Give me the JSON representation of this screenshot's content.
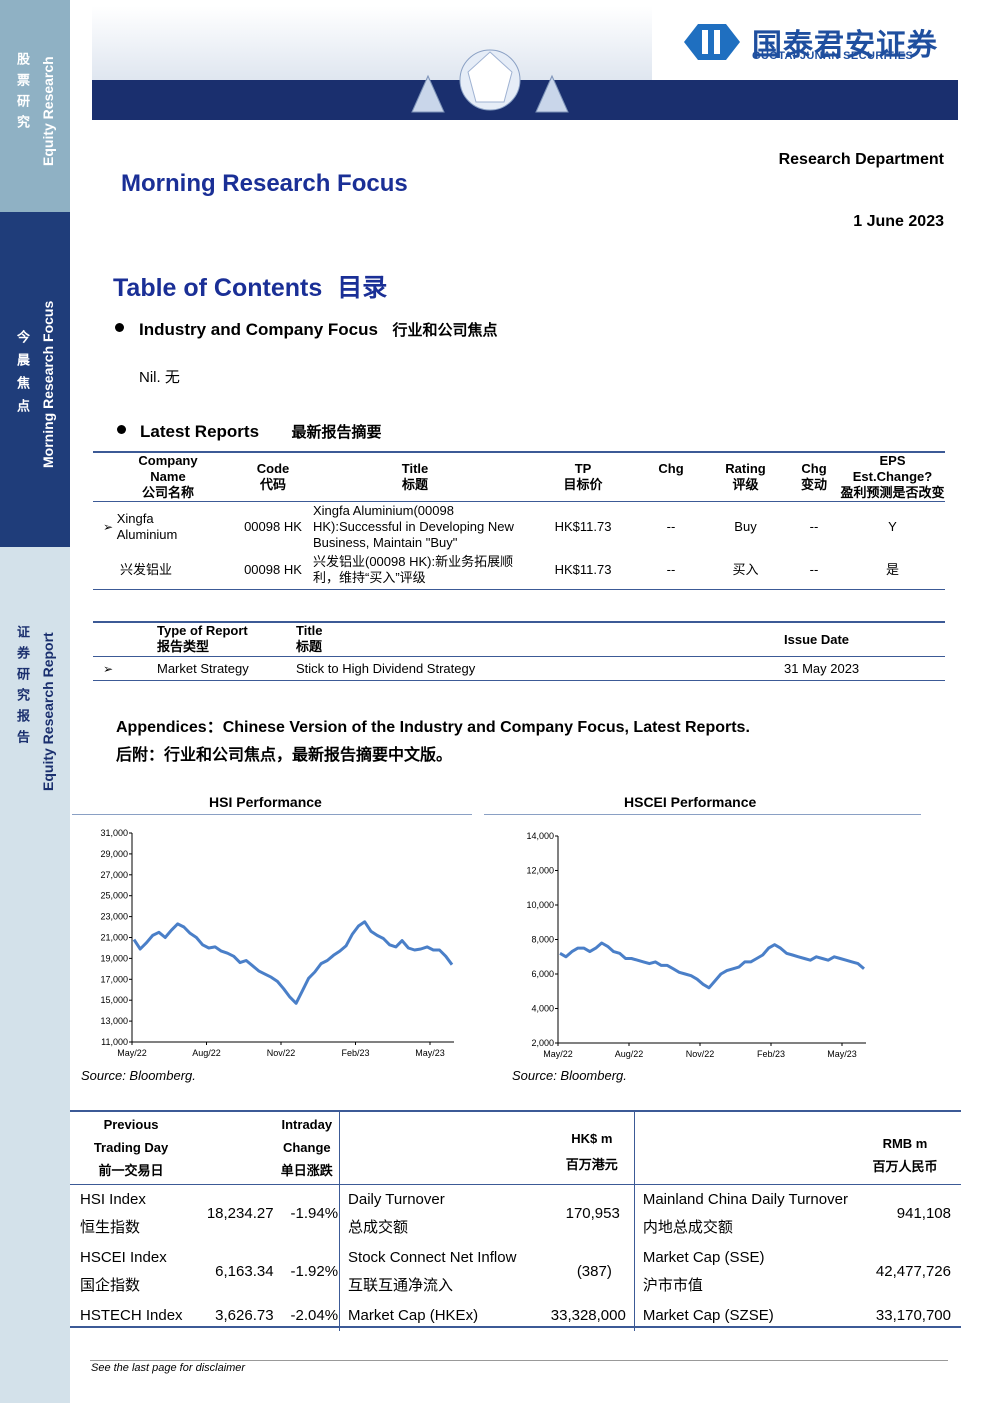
{
  "sidebar": {
    "block1_cn": "股票研究",
    "block1_en": "Equity Research",
    "block2_cn": "今晨焦点",
    "block2_en": "Morning Research Focus",
    "block3_cn": "证券研究报告",
    "block3_en": "Equity Research Report"
  },
  "header": {
    "logo_cn": "国泰君安证券",
    "logo_en": "GUOTAI JUNAN SECURITIES",
    "department": "Research Department",
    "title": "Morning Research Focus",
    "date": "1 June 2023"
  },
  "toc": {
    "title": "Table of Contents",
    "title_cn": "目录",
    "section1_en": "Industry and Company Focus",
    "section1_cn": "行业和公司焦点",
    "section1_body": "Nil.  无",
    "section2_en": "Latest Reports",
    "section2_cn": "最新报告摘要"
  },
  "latest_reports": {
    "headers": {
      "company_en": "Company",
      "company_en2": "Name",
      "company_cn": "公司名称",
      "code_en": "Code",
      "code_cn": "代码",
      "title_en": "Title",
      "title_cn": "标题",
      "tp_en": "TP",
      "tp_cn": "目标价",
      "chg": "Chg",
      "rating_en": "Rating",
      "rating_cn": "评级",
      "chg2_en": "Chg",
      "chg2_cn": "变动",
      "eps_en1": "EPS",
      "eps_en2": "Est.Change?",
      "eps_cn": "盈利预测是否改变"
    },
    "rows": [
      {
        "company": "Xingfa Aluminium",
        "code": "00098 HK",
        "title": "Xingfa Aluminium(00098 HK):Successful in Developing New Business, Maintain \"Buy\"",
        "tp": "HK$11.73",
        "chg": "--",
        "rating": "Buy",
        "chg2": "--",
        "eps": "Y"
      },
      {
        "company": "兴发铝业",
        "code": "00098 HK",
        "title": "兴发铝业(00098 HK):新业务拓展顺利，维持“买入”评级",
        "tp": "HK$11.73",
        "chg": "--",
        "rating": "买入",
        "chg2": "--",
        "eps": "是"
      }
    ],
    "bullet_glyph": "➢"
  },
  "strategy_reports": {
    "headers": {
      "type_en": "Type of Report",
      "type_cn": "报告类型",
      "title_en": "Title",
      "title_cn": "标题",
      "date": "Issue Date"
    },
    "rows": [
      {
        "type": "Market Strategy",
        "title": "Stick to High Dividend Strategy",
        "date": "31 May 2023"
      }
    ]
  },
  "appendix": {
    "line1": "Appendices：Chinese Version of the Industry and Company Focus, Latest Reports.",
    "line2": "后附：行业和公司焦点，最新报告摘要中文版。"
  },
  "chart_data": [
    {
      "type": "line",
      "title": "HSI Performance",
      "source": "Source: Bloomberg.",
      "x_ticks": [
        "May/22",
        "Aug/22",
        "Nov/22",
        "Feb/23",
        "May/23"
      ],
      "y_ticks": [
        "31,000",
        "29,000",
        "27,000",
        "25,000",
        "23,000",
        "21,000",
        "19,000",
        "17,000",
        "15,000",
        "13,000",
        "11,000"
      ],
      "ylim": [
        11000,
        31000
      ],
      "color": "#4a7fc8",
      "series": [
        {
          "values": [
            20800,
            19900,
            20500,
            21200,
            21500,
            21000,
            21700,
            22300,
            22000,
            21400,
            21000,
            20300,
            20000,
            20100,
            19700,
            19500,
            19200,
            18600,
            18800,
            18300,
            17800,
            17500,
            17200,
            16800,
            16100,
            15300,
            14700,
            15900,
            17100,
            17700,
            18500,
            18800,
            19300,
            19700,
            20200,
            21300,
            22100,
            22500,
            21600,
            21200,
            20900,
            20300,
            20100,
            20700,
            20000,
            19800,
            19900,
            20100,
            19800,
            19800,
            19200,
            18400
          ]
        }
      ]
    },
    {
      "type": "line",
      "title": "HSCEI Performance",
      "source": "Source: Bloomberg.",
      "x_ticks": [
        "May/22",
        "Aug/22",
        "Nov/22",
        "Feb/23",
        "May/23"
      ],
      "y_ticks": [
        "14,000",
        "12,000",
        "10,000",
        "8,000",
        "6,000",
        "4,000",
        "2,000"
      ],
      "ylim": [
        2000,
        14000
      ],
      "color": "#4a7fc8",
      "series": [
        {
          "values": [
            7200,
            7000,
            7300,
            7500,
            7500,
            7300,
            7500,
            7800,
            7600,
            7300,
            7200,
            6900,
            6900,
            6800,
            6700,
            6600,
            6700,
            6500,
            6500,
            6300,
            6100,
            6000,
            5900,
            5700,
            5400,
            5200,
            5600,
            6000,
            6200,
            6300,
            6400,
            6700,
            6700,
            6900,
            7100,
            7500,
            7700,
            7500,
            7200,
            7100,
            7000,
            6900,
            6800,
            7000,
            6900,
            6800,
            7000,
            6900,
            6800,
            6700,
            6600,
            6300
          ]
        }
      ]
    }
  ],
  "market_table": {
    "header_prev": [
      "Previous",
      "Trading Day",
      "前一交易日"
    ],
    "header_intraday": [
      "Intraday",
      "Change",
      "单日涨跌"
    ],
    "header_hkd": [
      "HK$ m",
      "百万港元"
    ],
    "header_rmb": [
      "RMB m",
      "百万人民币"
    ],
    "rows": [
      {
        "name": "HSI Index",
        "name_cn": "恒生指数",
        "value": "18,234.27",
        "chg": "-1.94%",
        "item": "Daily Turnover",
        "item_cn": "总成交额",
        "hkd": "170,953",
        "item2": "Mainland China Daily Turnover",
        "item2_cn": "内地总成交额",
        "rmb": "941,108"
      },
      {
        "name": "HSCEI Index",
        "name_cn": "国企指数",
        "value": "6,163.34",
        "chg": "-1.92%",
        "item": "Stock Connect Net Inflow",
        "item_cn": "互联互通净流入",
        "hkd": "(387)",
        "item2": "Market Cap (SSE)",
        "item2_cn": "沪市市值",
        "rmb": "42,477,726"
      },
      {
        "name": "HSTECH Index",
        "name_cn": "",
        "value": "3,626.73",
        "chg": "-2.04%",
        "item": "Market Cap (HKEx)",
        "item_cn": "",
        "hkd": "33,328,000",
        "item2": "Market Cap (SZSE)",
        "item2_cn": "",
        "rmb": "33,170,700"
      }
    ]
  },
  "footer": {
    "disclaimer": "See the last page for disclaimer"
  }
}
